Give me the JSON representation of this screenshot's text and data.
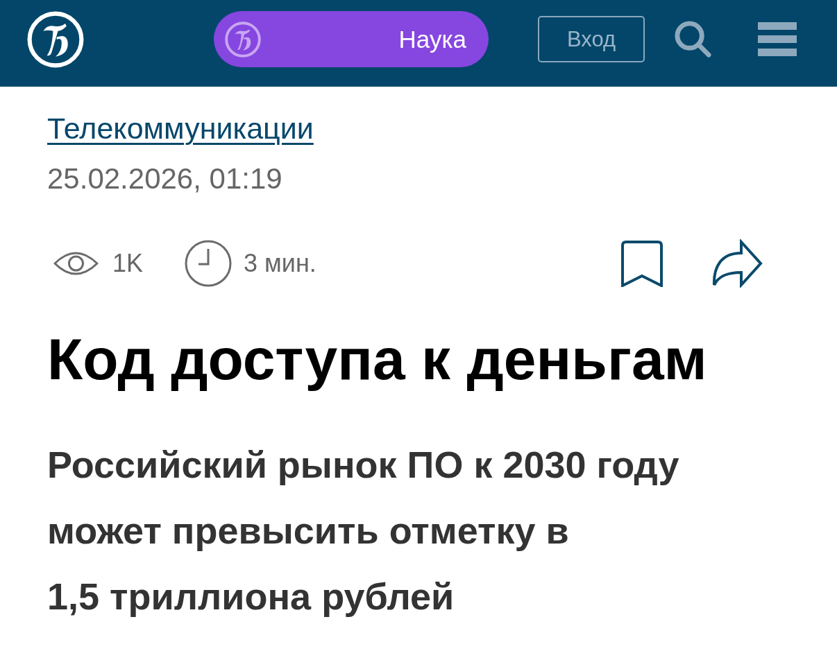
{
  "header": {
    "section": "Наука",
    "login_button": "Вход"
  },
  "article": {
    "category": "Телекоммуникации",
    "date": "25.02.2026, 01:19",
    "views": "1K",
    "read_time": "3 мин.",
    "title": "Код доступа к деньгам",
    "subtitle": "Российский рынок ПО к 2030 году может превысить отметку в 1,5 триллиона рублей"
  }
}
